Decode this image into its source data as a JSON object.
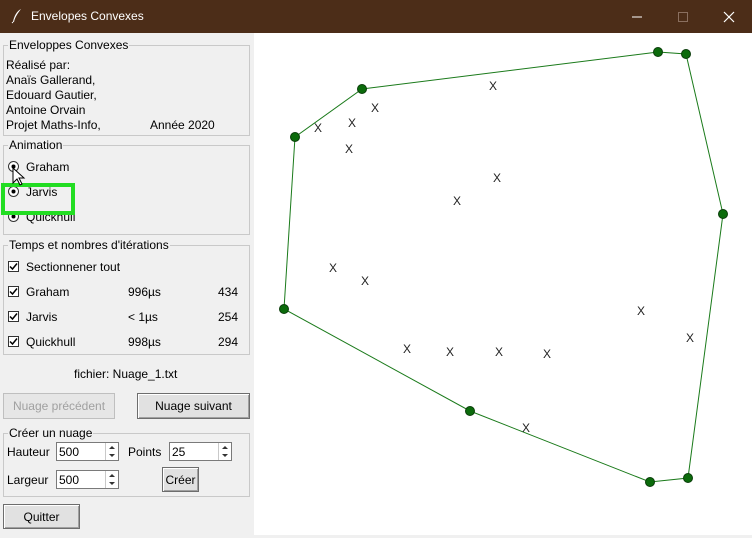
{
  "window": {
    "title": "Envelopes Convexes"
  },
  "info": {
    "legend": "Enveloppes Convexes",
    "made_by": "Réalisé par:",
    "authors": [
      "Anaïs Gallerand,",
      "Edouard Gautier,",
      "Antoine Orvain"
    ],
    "project": "Projet Maths-Info,",
    "year": "Année 2020"
  },
  "animation": {
    "legend": "Animation",
    "options": [
      {
        "label": "Graham",
        "selected": true
      },
      {
        "label": "Jarvis",
        "selected": true
      },
      {
        "label": "Quickhull",
        "selected": true
      }
    ]
  },
  "timing": {
    "legend": "Temps et nombres d'itérations",
    "select_all": {
      "label": "Sectionnener tout",
      "checked": true
    },
    "rows": [
      {
        "label": "Graham",
        "time": "996µs",
        "iterations": "434",
        "checked": true
      },
      {
        "label": "Jarvis",
        "time": "< 1µs",
        "iterations": "254",
        "checked": true
      },
      {
        "label": "Quickhull",
        "time": "998µs",
        "iterations": "294",
        "checked": true
      }
    ]
  },
  "file": {
    "label": "fichier: Nuage_1.txt"
  },
  "nav": {
    "prev": "Nuage précédent",
    "next": "Nuage suivant"
  },
  "create": {
    "legend": "Créer un nuage",
    "height_label": "Hauteur",
    "height_value": "500",
    "points_label": "Points",
    "points_value": "25",
    "width_label": "Largeur",
    "width_value": "500",
    "button": "Créer"
  },
  "quit": "Quitter",
  "canvas": {
    "hull_color": "#1a7a1a",
    "point_color": "#0b6b0b",
    "hull_points": [
      [
        658,
        52
      ],
      [
        686,
        54
      ],
      [
        723,
        214
      ],
      [
        688,
        478
      ],
      [
        650,
        482
      ],
      [
        470,
        411
      ],
      [
        284,
        309
      ],
      [
        295,
        137
      ],
      [
        362,
        89
      ]
    ],
    "interior_points": [
      [
        493,
        86
      ],
      [
        375,
        108
      ],
      [
        352,
        123
      ],
      [
        318,
        128
      ],
      [
        349,
        149
      ],
      [
        497,
        178
      ],
      [
        457,
        201
      ],
      [
        333,
        268
      ],
      [
        365,
        281
      ],
      [
        641,
        311
      ],
      [
        690,
        338
      ],
      [
        407,
        349
      ],
      [
        450,
        352
      ],
      [
        499,
        352
      ],
      [
        547,
        354
      ],
      [
        526,
        428
      ]
    ],
    "interior_mark": "X"
  }
}
